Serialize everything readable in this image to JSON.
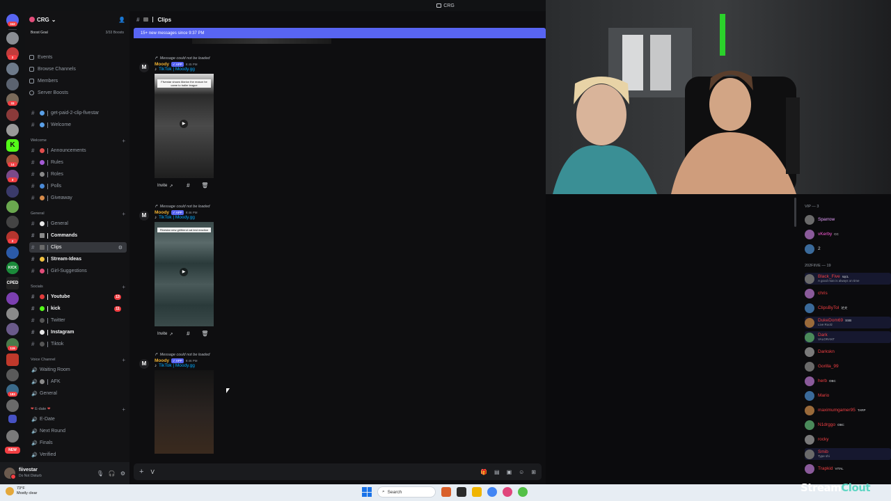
{
  "titlebar": {
    "title": "CRG"
  },
  "rail": {
    "items": [
      {
        "badge": "342"
      },
      {
        "badge": ""
      },
      {
        "badge": "2"
      },
      {
        "badge": ""
      },
      {
        "badge": ""
      },
      {
        "badge": "33"
      },
      {
        "badge": ""
      },
      {
        "badge": ""
      },
      {
        "badge": ""
      },
      {
        "badge": "14"
      },
      {
        "badge": "3"
      },
      {
        "badge": ""
      },
      {
        "badge": ""
      },
      {
        "badge": ""
      },
      {
        "badge": ""
      },
      {
        "badge": ""
      },
      {
        "badge": "2"
      },
      {
        "badge": ""
      },
      {
        "badge": ""
      },
      {
        "badge": ""
      },
      {
        "badge": ""
      },
      {
        "badge": ""
      },
      {
        "badge": "119"
      },
      {
        "badge": ""
      },
      {
        "badge": ""
      },
      {
        "badge": "183"
      },
      {
        "badge": ""
      },
      {
        "badge": ""
      },
      {
        "badge": "NEW"
      }
    ],
    "label_kick": "KICK",
    "label_crped": "CPED"
  },
  "server": {
    "name": "CRG",
    "boost_label": "Boost Goal",
    "boost_count": "3/33 Boosts"
  },
  "nav": [
    "Events",
    "Browse Channels",
    "Members",
    "Server Boosts"
  ],
  "top_channels": [
    "get-paid-2-clip-fivestar",
    "Welcome"
  ],
  "categories": {
    "welcome": "Welcome",
    "general": "General",
    "socials": "Socials",
    "voice": "Voice Channel",
    "edate": "E-date"
  },
  "welcome_channels": [
    "Announcements",
    "Rules",
    "Roles",
    "Polls",
    "Giveaway"
  ],
  "general_channels": [
    "General",
    "Commands",
    "Clips",
    "Stream-Ideas",
    "Girl-Suggestions"
  ],
  "social_channels": [
    {
      "name": "Youtube",
      "badge": "13"
    },
    {
      "name": "kick",
      "badge": "11"
    },
    {
      "name": "Twitter",
      "badge": ""
    },
    {
      "name": "Instagram",
      "badge": ""
    },
    {
      "name": "Tiktok",
      "badge": ""
    }
  ],
  "voice_channels": [
    "Waiting Room",
    "AFK",
    "General"
  ],
  "edate_channels": [
    "E-Date",
    "Next Round",
    "Finals",
    "Verified"
  ],
  "user": {
    "name": "fiivestar",
    "status": "Do Not Disturb"
  },
  "chat": {
    "channel": "Clips",
    "new_banner": "15+ new messages since 9:37 PM",
    "reply_text": "Message could not be loaded",
    "author": "Moody",
    "app_tag": "✓ APP",
    "link": "TikTok | Moody.gg",
    "invite": "Invite",
    "times": [
      "9:45 PM",
      "9:46 PM",
      "9:46 PM"
    ],
    "captions": [
      "Fiivestar shows Marlon the reason he came to baller league",
      "Fiivestar new girlfriend cat test reaction"
    ],
    "composer_text": "V"
  },
  "members": {
    "vip_header": "VIP — 3",
    "vip": [
      {
        "name": "Sparrow",
        "color": "#e8a0ff",
        "tag": ""
      },
      {
        "name": "vKerby",
        "color": "#ff5cdb",
        "tag": "CC"
      },
      {
        "name": "2",
        "color": "#dbdee1",
        "tag": ""
      }
    ],
    "group_header": "202FIIVE — 19",
    "list": [
      {
        "name": "Black_Five",
        "color": "#f23f43",
        "sub": "A good man is always on time",
        "tag": "sqcL"
      },
      {
        "name": "chris",
        "color": "#f23f43",
        "sub": "",
        "tag": ""
      },
      {
        "name": "ClipsByTol",
        "color": "#f23f43",
        "sub": "",
        "tag": "达文"
      },
      {
        "name": "DukeDom69",
        "color": "#f23f43",
        "sub": "Live Roolz",
        "tag": "SSB"
      },
      {
        "name": "Dark",
        "color": "#f23f43",
        "sub": "VALORANT",
        "tag": ""
      },
      {
        "name": "Darkskn",
        "color": "#f23f43",
        "sub": "",
        "tag": ""
      },
      {
        "name": "Gorilla_99",
        "color": "#f23f43",
        "sub": "",
        "tag": ""
      },
      {
        "name": "herb",
        "color": "#f23f43",
        "sub": "",
        "tag": "OBC"
      },
      {
        "name": "Mario",
        "color": "#f23f43",
        "sub": "",
        "tag": ""
      },
      {
        "name": "maximumgamer95",
        "color": "#f23f43",
        "sub": "",
        "tag": "TARP"
      },
      {
        "name": "N1drggo",
        "color": "#f23f43",
        "sub": "",
        "tag": "OBC"
      },
      {
        "name": "rocky",
        "color": "#f23f43",
        "sub": "",
        "tag": ""
      },
      {
        "name": "Smib",
        "color": "#f23f43",
        "sub": "Type shi",
        "tag": ""
      },
      {
        "name": "Trapkid",
        "color": "#f23f43",
        "sub": "",
        "tag": "VITAL"
      }
    ]
  },
  "taskbar": {
    "temp": "73°F",
    "weather": "Mostly clear",
    "search": "Search"
  },
  "brand": {
    "text1": "Stream",
    "text2": "Clout"
  }
}
